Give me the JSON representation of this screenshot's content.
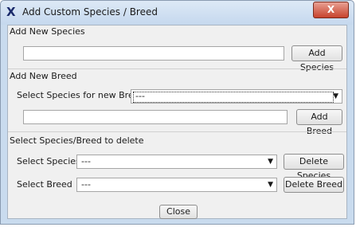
{
  "window": {
    "title": "Add Custom Species / Breed",
    "close_glyph": "X",
    "icon_glyph": "X"
  },
  "add_species": {
    "section_label": "Add New Species",
    "input_value": "",
    "button": "Add Species"
  },
  "add_breed": {
    "section_label": "Add New Breed",
    "select_label": "Select Species for new Breed:",
    "select_value": "---",
    "input_value": "",
    "button": "Add Breed"
  },
  "delete": {
    "section_label": "Select Species/Breed to delete",
    "species_label": "Select Species",
    "species_value": "---",
    "species_button": "Delete Species",
    "breed_label": "Select Breed",
    "breed_value": "---",
    "breed_button": "Delete Breed"
  },
  "footer": {
    "close": "Close"
  },
  "icons": {
    "dropdown": "chevron-down-icon"
  }
}
